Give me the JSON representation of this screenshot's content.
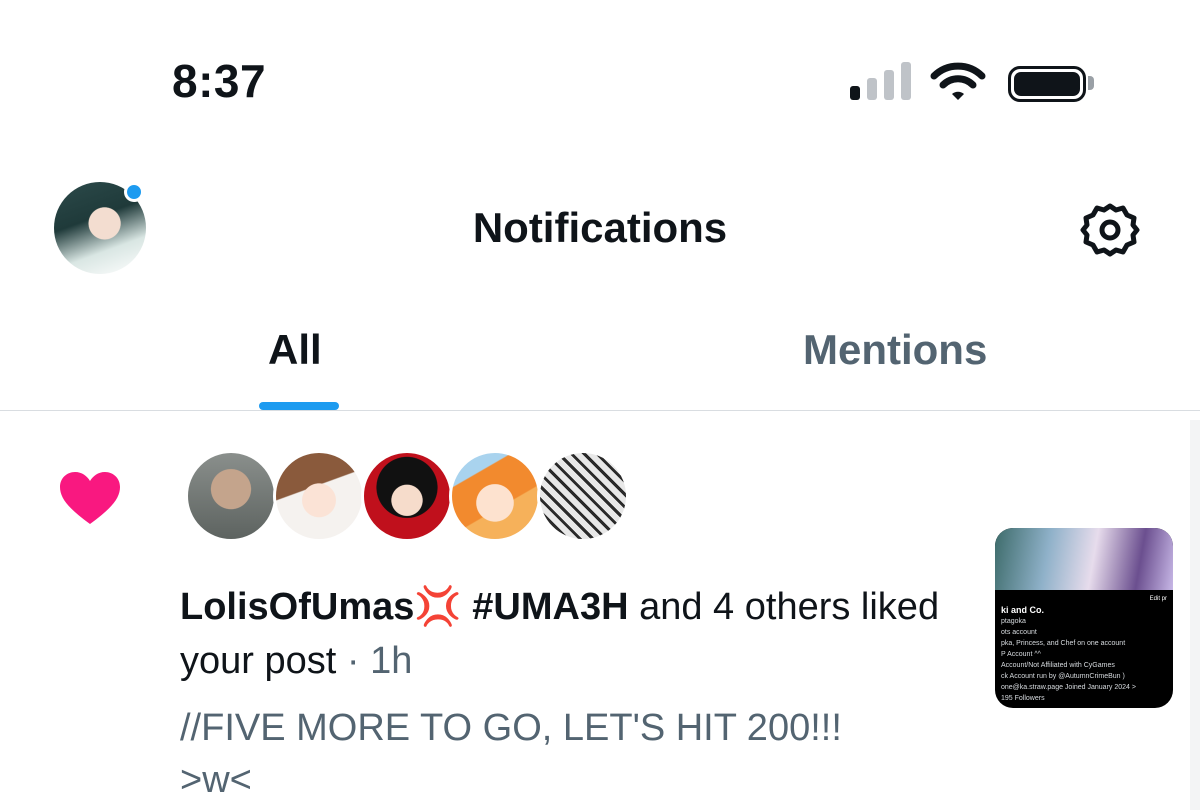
{
  "status_bar": {
    "time": "8:37",
    "signal_bars_active": 1,
    "signal_bars_total": 4
  },
  "header": {
    "title": "Notifications",
    "has_unread_dot": true,
    "settings_icon": "gear-icon"
  },
  "tabs": [
    {
      "label": "All",
      "selected": true
    },
    {
      "label": "Mentions",
      "selected": false
    }
  ],
  "notification": {
    "type_icon": "heart-icon",
    "liker_count_shown": 5,
    "actor_name": "LolisOfUmas",
    "actor_emoji": "💢",
    "actor_tag": "#UMA3H",
    "others_text": "and 4",
    "action_text": "others liked your post",
    "separator": "·",
    "time_ago": "1h",
    "post_text": "//FIVE MORE TO GO, LET'S HIT 200!!!",
    "post_text_line2": ">w<",
    "thumbnail": {
      "title": "ki and Co.",
      "edit_button": "Edit pr",
      "lines": [
        "ptagoka",
        "ots account",
        "pka, Princess, and Chef on one account",
        "P Account ^^",
        "Account/Not Affiliated with CyGames",
        "ck Account run by @AutumnCrimeBun )",
        "one@ka.straw.page  Joined January 2024 >",
        "195 Followers"
      ]
    }
  },
  "colors": {
    "accent": "#1d9bf0",
    "like": "#f91880",
    "secondary_text": "#536471",
    "primary_text": "#0f1419"
  }
}
